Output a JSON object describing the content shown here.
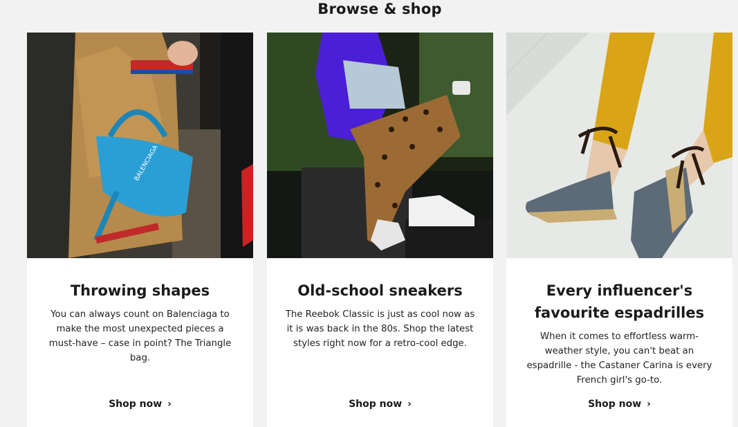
{
  "section": {
    "title": "Browse & shop"
  },
  "cards": [
    {
      "title": "Throwing shapes",
      "description": "You can always count on Balenciaga to make the most unexpected pieces a must-have – case in point? The Triangle bag.",
      "link": "Shop now",
      "image_alt": "Street style: blue Balenciaga triangle bag",
      "bag_text": "BALENCIAGA"
    },
    {
      "title": "Old-school sneakers",
      "description": "The Reebok Classic is just as cool now as it is was back in the 80s. Shop the latest styles right now for a retro-cool edge.",
      "link": "Shop now",
      "image_alt": "Street style: white Reebok Classic sneakers"
    },
    {
      "title": "Every influencer's favourite espadrilles",
      "description": "When it comes to effortless warm-weather style, you can't beat an espadrille - the Castaner Carina is every French girl's go-to.",
      "link": "Shop now",
      "image_alt": "Espadrille wedges with ankle ties"
    }
  ],
  "colors": {
    "background": "#f2f2f2",
    "card": "#ffffff",
    "text": "#1a1a1a",
    "bag_blue": "#2a9fd6",
    "jacket_purple": "#4b1fd6",
    "trouser_yellow": "#d9a516"
  },
  "icons": {
    "link_chevron": "chevron-right-icon"
  }
}
